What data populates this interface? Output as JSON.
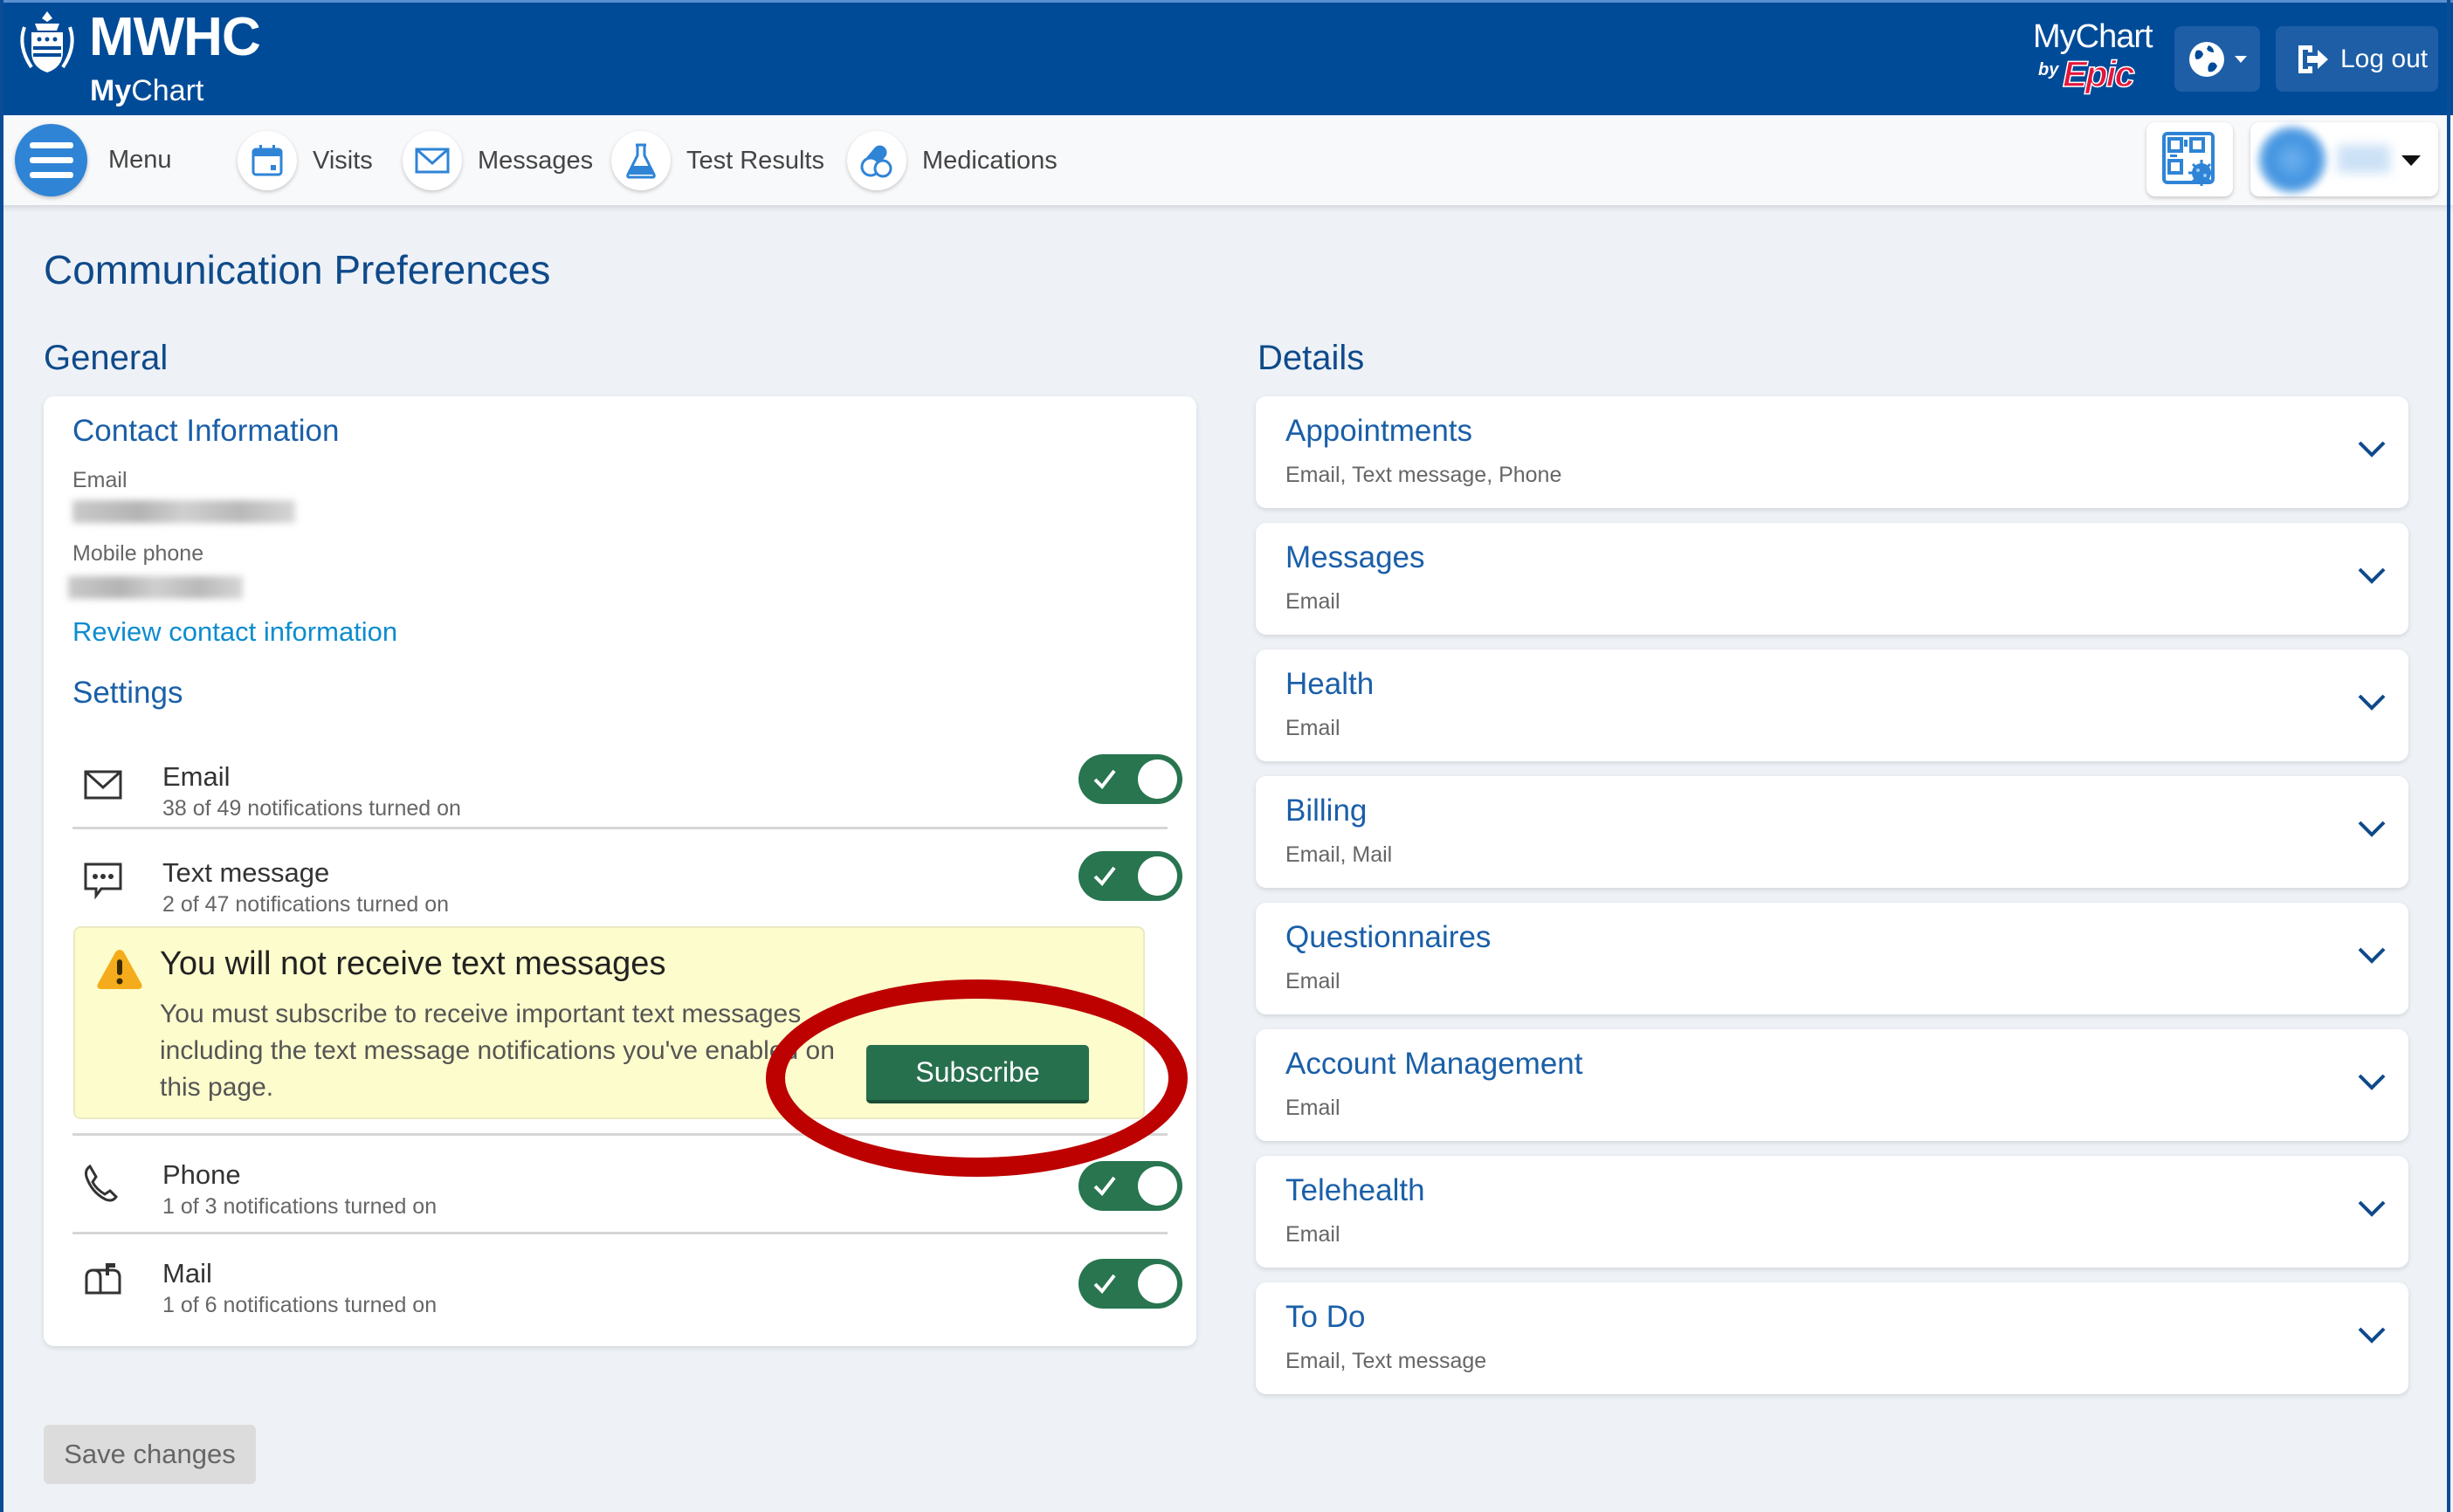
{
  "header": {
    "brand": "MWHC",
    "brand_sub_bold": "My",
    "brand_sub_rest": "Chart",
    "epic_logo_my": "MyChart",
    "epic_logo_by": "by",
    "epic_logo_epic": "Epic",
    "logout_label": "Log out"
  },
  "nav": {
    "menu_label": "Menu",
    "items": [
      {
        "label": "Visits",
        "icon": "calendar-icon"
      },
      {
        "label": "Messages",
        "icon": "envelope-icon"
      },
      {
        "label": "Test Results",
        "icon": "flask-icon"
      },
      {
        "label": "Medications",
        "icon": "pills-icon"
      }
    ]
  },
  "page": {
    "title": "Communication Preferences",
    "general_heading": "General",
    "details_heading": "Details"
  },
  "contact": {
    "heading": "Contact Information",
    "email_label": "Email",
    "mobile_label": "Mobile phone",
    "review_link": "Review contact information"
  },
  "settings": {
    "heading": "Settings",
    "rows": [
      {
        "title": "Email",
        "subtitle": "38 of 49 notifications turned on",
        "enabled": true
      },
      {
        "title": "Text message",
        "subtitle": "2 of 47 notifications turned on",
        "enabled": true
      },
      {
        "title": "Phone",
        "subtitle": "1 of 3 notifications turned on",
        "enabled": true
      },
      {
        "title": "Mail",
        "subtitle": "1 of 6 notifications turned on",
        "enabled": true
      }
    ]
  },
  "warning": {
    "title": "You will not receive text messages",
    "body": "You must subscribe to receive important text messages including the text message notifications you've enabled on this page.",
    "button": "Subscribe"
  },
  "details": [
    {
      "title": "Appointments",
      "channels": "Email, Text message, Phone"
    },
    {
      "title": "Messages",
      "channels": "Email"
    },
    {
      "title": "Health",
      "channels": "Email"
    },
    {
      "title": "Billing",
      "channels": "Email, Mail"
    },
    {
      "title": "Questionnaires",
      "channels": "Email"
    },
    {
      "title": "Account Management",
      "channels": "Email"
    },
    {
      "title": "Telehealth",
      "channels": "Email"
    },
    {
      "title": "To Do",
      "channels": "Email, Text message"
    }
  ],
  "footer": {
    "save_label": "Save changes"
  },
  "colors": {
    "header_bg": "#004b98",
    "toggle_on": "#287550",
    "subscribe_bg": "#27704e",
    "warning_bg": "#fdfccc",
    "annotation": "#bd0000",
    "heading_blue": "#0f4a8a",
    "link_blue": "#0d8ccf"
  }
}
